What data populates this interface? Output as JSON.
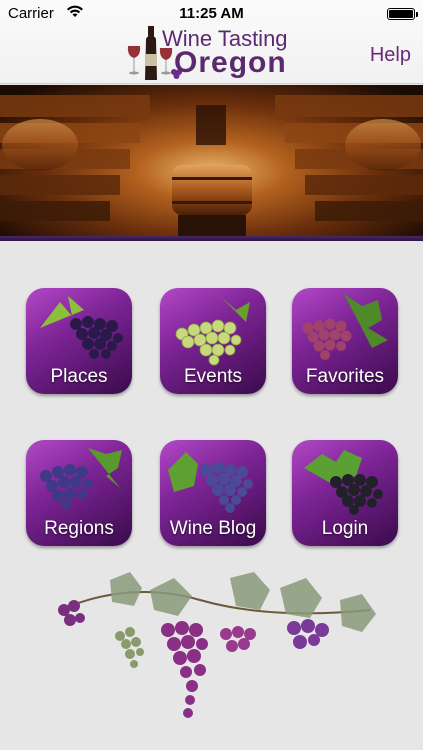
{
  "status_bar": {
    "carrier": "Carrier",
    "time": "11:25 AM",
    "battery_level_fraction": 1.0
  },
  "header": {
    "logo_line1": "Wine Tasting",
    "logo_line2": "Oregon",
    "help_label": "Help"
  },
  "menu": {
    "places_label": "Places",
    "events_label": "Events",
    "favorites_label": "Favorites",
    "regions_label": "Regions",
    "wine_blog_label": "Wine Blog",
    "login_label": "Login"
  },
  "colors": {
    "brand_purple": "#5b2a6e",
    "tile_purple": "#7d2496",
    "background": "#e6e6e6"
  }
}
